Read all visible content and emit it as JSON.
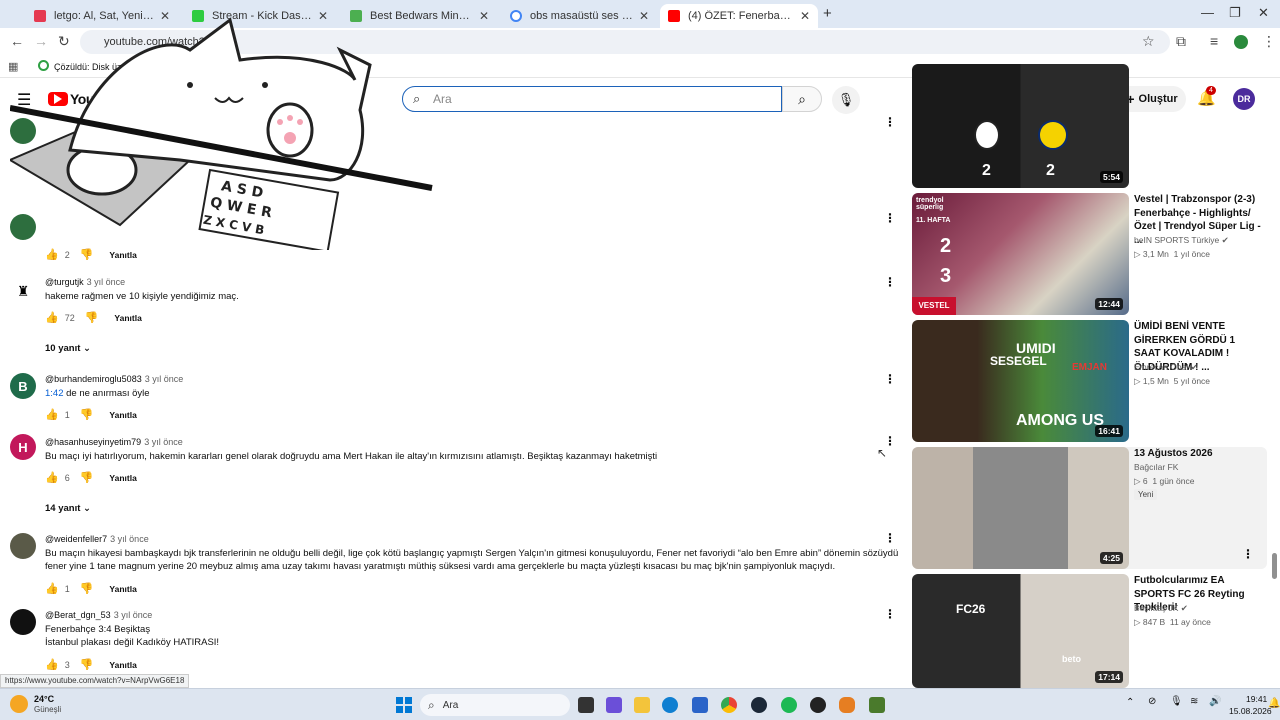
{
  "browser": {
    "tabs": [
      {
        "label": "letgo: Al, Sat, Yenile - Araba, Ele",
        "color": "#e53950"
      },
      {
        "label": "Stream - Kick Dashboard",
        "color": "#2ecc40"
      },
      {
        "label": "Best Bedwars Minecraft Servers",
        "color": "#4caf50"
      },
      {
        "label": "obs masaüstü ses gelmi - Goog",
        "color": "#4285f4"
      },
      {
        "label": "(4) ÖZET: Fenerbahçe 3-4 Beşikt",
        "color": "#ff0000"
      }
    ],
    "url": "youtube.com/watch?v=...",
    "bookmark": "Çözüldü: Disk üzeri..."
  },
  "youtube": {
    "logo": "YouTube",
    "search_placeholder": "Ara",
    "create_label": "Oluştur",
    "notification_count": "4",
    "avatar_initials": "DR"
  },
  "comments": [
    {
      "likes": "2",
      "reply": "Yanıtla"
    },
    {
      "author": "@turgutjk",
      "time": "3 yıl önce",
      "text": "hakeme rağmen ve 10 kişiyle yendiğimiz maç.",
      "likes": "72",
      "reply": "Yanıtla",
      "replies": "10 yanıt"
    },
    {
      "author": "@burhandemiroglu5083",
      "time": "3 yıl önce",
      "timestamp": "1:42",
      "text": " de ne anırması öyle",
      "likes": "1",
      "reply": "Yanıtla",
      "avatar_letter": "B"
    },
    {
      "author": "@hasanhuseyinyetim79",
      "time": "3 yıl önce",
      "text": "Bu maçı iyi hatırlıyorum, hakemin kararları genel olarak doğruydu ama Mert Hakan ile altay'ın kırmızısını atlamıştı. Beşiktaş kazanmayı haketmişti",
      "likes": "6",
      "reply": "Yanıtla",
      "replies": "14 yanıt",
      "avatar_letter": "H"
    },
    {
      "author": "@weidenfeller7",
      "time": "3 yıl önce",
      "text": "Bu maçın hikayesi bambaşkaydı bjk transferlerinin ne olduğu belli değil, lige çok kötü başlangıç yapmıştı Sergen Yalçın'ın gitmesi konuşuluyordu, Fener net favoriydi “alo ben Emre abin” dönemin sözüydü fener yine  1 tane magnum yerine 20 meybuz almış ama  uzay takımı havası yaratmıştı müthiş süksesi vardı ama gerçeklerle bu maçta yüzleşti kısacası bu maç bjk'nin şampiyonluk maçıydı.",
      "likes": "1",
      "reply": "Yanıtla"
    },
    {
      "author": "@Berat_dgn_53",
      "time": "3 yıl önce",
      "text_line1": "Fenerbahçe 3:4 Beşiktaş",
      "text_line2": "İstanbul plakası  değil Kadıköy HATIRASI!",
      "likes": "3",
      "reply": "Yanıtla"
    }
  ],
  "recommendations": [
    {
      "duration": "5:54",
      "score_left": "2",
      "score_right": "2"
    },
    {
      "title": "Vestel | Trabzonspor (2-3) Fenerbahçe - Highlights/Özet | Trendyol Süper Lig - ...",
      "channel": "beIN SPORTS Türkiye",
      "views": "3,1 Mn",
      "age": "1 yıl önce",
      "duration": "12:44",
      "thumb_week": "11. HAFTA",
      "thumb_s1": "2",
      "thumb_s2": "3",
      "thumb_brand": "trendyol süperlig",
      "thumb_sponsor": "VESTEL"
    },
    {
      "title": "ÜMİDİ BENİ VENTE GİRERKEN GÖRDÜ 1 SAAT KOVALADIM ! ÖLDÜRDÜM ! ...",
      "channel": "Emrecan Önal",
      "views": "1,5 Mn",
      "age": "5 yıl önce",
      "duration": "16:41",
      "thumb_t1": "UMIDI",
      "thumb_t2": "SESEGEL",
      "thumb_t3": "EMJAN",
      "thumb_t4": "AMONG US"
    },
    {
      "title": "13 Ağustos 2026",
      "channel": "Bağcılar FK",
      "views": "6",
      "age": "1 gün önce",
      "duration": "4:25",
      "badge": "Yeni"
    },
    {
      "title": "Futbolcularımız EA SPORTS FC 26 Reyting Tepkileri!",
      "channel": "Beşiktaş JK",
      "views": "847 B",
      "age": "11 ay önce",
      "duration": "17:14",
      "thumb_t1": "FC26",
      "thumb_t2": "beto"
    }
  ],
  "overlay": {
    "keys_row1": "A S D",
    "keys_row2": "Q W E R",
    "keys_row3": "Z X C V B"
  },
  "status_url": "https://www.youtube.com/watch?v=NArpVwG6E18",
  "taskbar": {
    "weather_temp": "24°C",
    "weather_desc": "Güneşli",
    "search": "Ara",
    "time": "19:41",
    "date": "15.08.2026"
  },
  "colors": {
    "accent": "#065fd4",
    "youtube_red": "#ff0000",
    "tab_bg": "#dfe8f4"
  }
}
